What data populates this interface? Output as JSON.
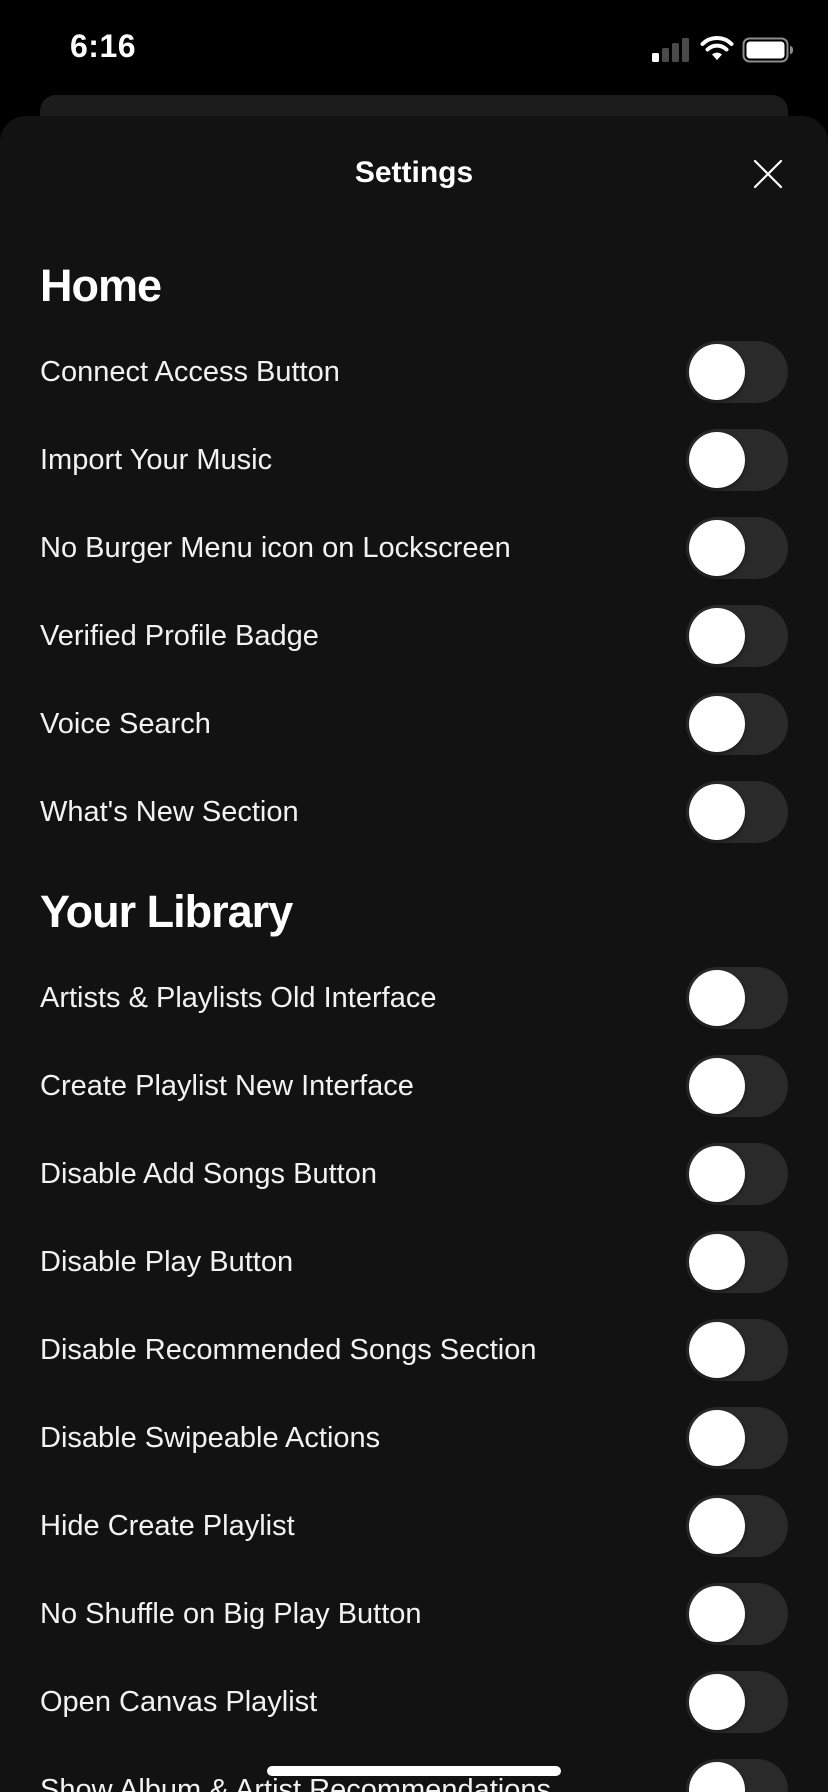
{
  "status_bar": {
    "time": "6:16",
    "icons": [
      "cell-signal-icon",
      "wifi-icon",
      "battery-icon"
    ]
  },
  "sheet": {
    "title": "Settings",
    "close_icon": "close-icon"
  },
  "sections": [
    {
      "title": "Home",
      "items": [
        {
          "label": "Connect Access Button",
          "enabled": false
        },
        {
          "label": "Import Your Music",
          "enabled": false
        },
        {
          "label": "No Burger Menu icon on Lockscreen",
          "enabled": false
        },
        {
          "label": "Verified Profile Badge",
          "enabled": false
        },
        {
          "label": "Voice Search",
          "enabled": false
        },
        {
          "label": "What's New Section",
          "enabled": false
        }
      ]
    },
    {
      "title": "Your Library",
      "items": [
        {
          "label": "Artists & Playlists Old Interface",
          "enabled": false
        },
        {
          "label": "Create Playlist New Interface",
          "enabled": false
        },
        {
          "label": "Disable Add Songs Button",
          "enabled": false
        },
        {
          "label": "Disable Play Button",
          "enabled": false
        },
        {
          "label": "Disable Recommended Songs Section",
          "enabled": false
        },
        {
          "label": "Disable Swipeable Actions",
          "enabled": false
        },
        {
          "label": "Hide Create Playlist",
          "enabled": false
        },
        {
          "label": "No Shuffle on Big Play Button",
          "enabled": false
        },
        {
          "label": "Open Canvas Playlist",
          "enabled": false
        },
        {
          "label": "Show Album & Artist Recommendations",
          "enabled": false
        }
      ]
    }
  ],
  "colors": {
    "background": "#000000",
    "sheet": "#121212",
    "toggle_off_track": "#2a2a2a",
    "knob": "#ffffff",
    "text": "#ffffff"
  }
}
